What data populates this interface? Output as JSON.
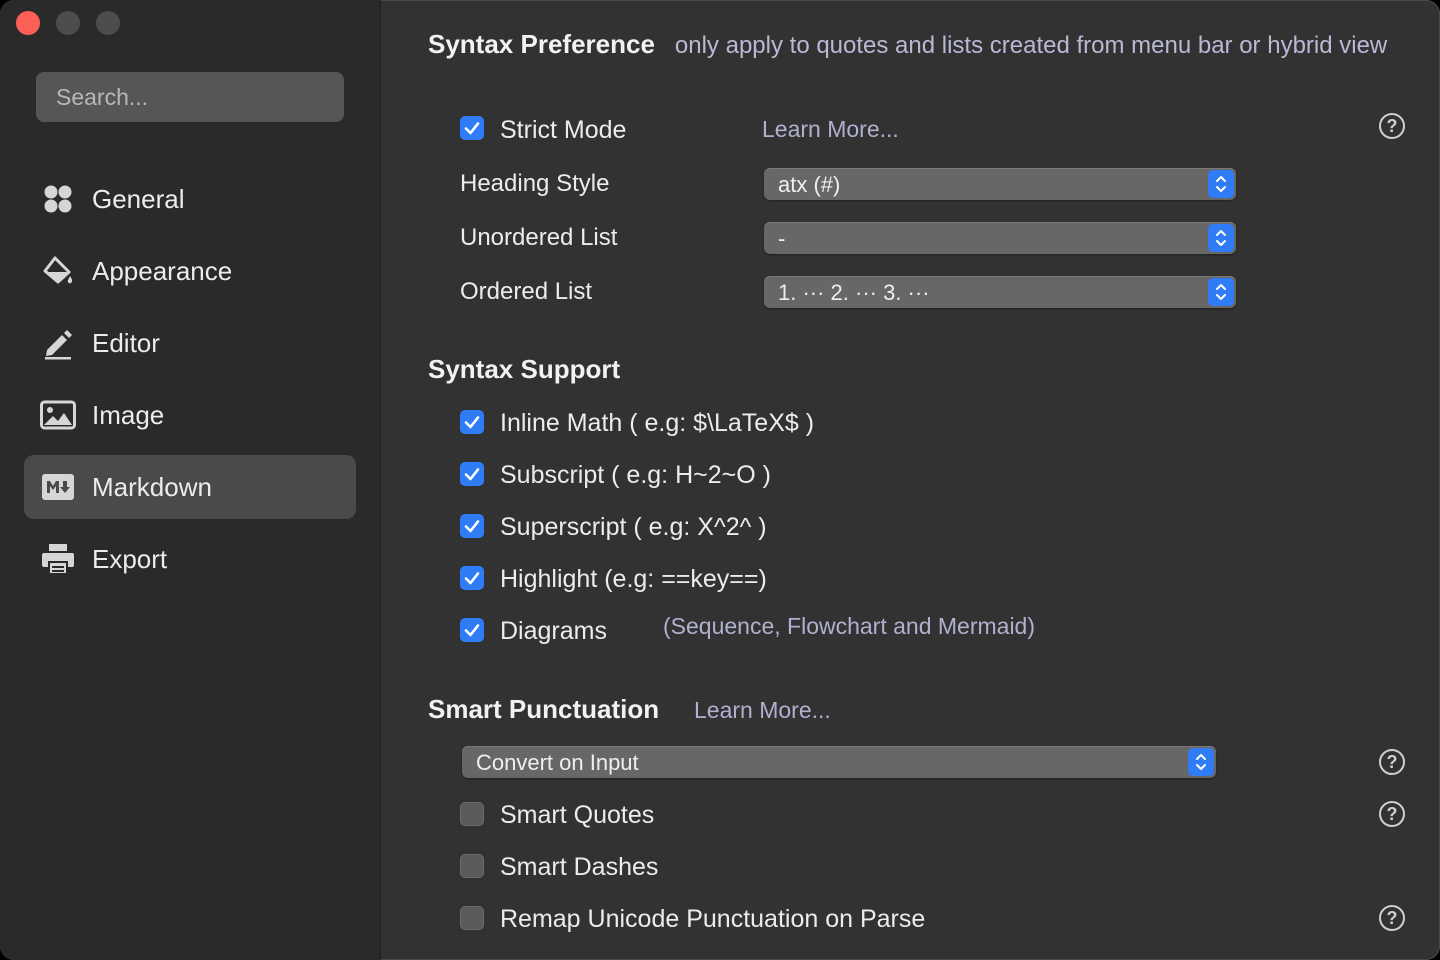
{
  "sidebar": {
    "search_placeholder": "Search...",
    "items": [
      {
        "label": "General",
        "icon": "grid-icon"
      },
      {
        "label": "Appearance",
        "icon": "paint-bucket-icon"
      },
      {
        "label": "Editor",
        "icon": "pencil-icon"
      },
      {
        "label": "Image",
        "icon": "image-icon"
      },
      {
        "label": "Markdown",
        "icon": "markdown-icon"
      },
      {
        "label": "Export",
        "icon": "printer-icon"
      }
    ],
    "active": "Markdown"
  },
  "syntax_preference": {
    "title": "Syntax Preference",
    "description": "only apply to quotes and lists created from menu bar or hybrid view",
    "strict_mode": {
      "label": "Strict Mode",
      "checked": true,
      "learn_more": "Learn More..."
    },
    "heading_style": {
      "label": "Heading Style",
      "value": "atx (#)"
    },
    "unordered_list": {
      "label": "Unordered List",
      "value": "-"
    },
    "ordered_list": {
      "label": "Ordered List",
      "value": "1. ··· 2. ··· 3. ···"
    }
  },
  "syntax_support": {
    "title": "Syntax Support",
    "items": [
      {
        "label": "Inline Math ( e.g: $\\LaTeX$ )",
        "checked": true
      },
      {
        "label": "Subscript ( e.g: H~2~O )",
        "checked": true
      },
      {
        "label": "Superscript ( e.g: X^2^ )",
        "checked": true
      },
      {
        "label": "Highlight (e.g: ==key==)",
        "checked": true
      },
      {
        "label": "Diagrams",
        "checked": true,
        "note": "(Sequence, Flowchart and Mermaid)"
      }
    ]
  },
  "smart_punctuation": {
    "title": "Smart Punctuation",
    "learn_more": "Learn More...",
    "mode": "Convert on Input",
    "options": [
      {
        "label": "Smart Quotes",
        "checked": false
      },
      {
        "label": "Smart Dashes",
        "checked": false
      },
      {
        "label": "Remap Unicode Punctuation on Parse",
        "checked": false
      }
    ]
  },
  "help_glyph": "?",
  "colors": {
    "accent": "#2f7cf6",
    "close": "#fe5f57",
    "sidebar": "#2a2a2a",
    "content": "#323232"
  }
}
